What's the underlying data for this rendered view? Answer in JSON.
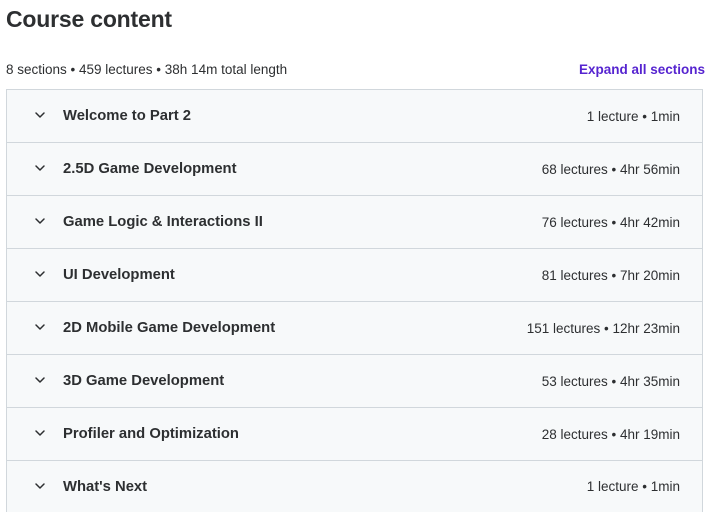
{
  "header": {
    "title": "Course content",
    "summary": "8 sections • 459 lectures • 38h 14m total length",
    "expand_all_label": "Expand all sections"
  },
  "sections": [
    {
      "title": "Welcome to Part 2",
      "meta": "1 lecture • 1min"
    },
    {
      "title": "2.5D Game Development",
      "meta": "68 lectures • 4hr 56min"
    },
    {
      "title": "Game Logic & Interactions II",
      "meta": "76 lectures • 4hr 42min"
    },
    {
      "title": "UI Development",
      "meta": "81 lectures • 7hr 20min"
    },
    {
      "title": "2D Mobile Game Development",
      "meta": "151 lectures • 12hr 23min"
    },
    {
      "title": "3D Game Development",
      "meta": "53 lectures • 4hr 35min"
    },
    {
      "title": "Profiler and Optimization",
      "meta": "28 lectures • 4hr 19min"
    },
    {
      "title": "What's Next",
      "meta": "1 lecture • 1min"
    }
  ],
  "icons": {
    "section_toggle": "chevron-down-icon"
  },
  "colors": {
    "text": "#2d2f31",
    "link": "#5624d0",
    "section_bg": "#f7f9fa",
    "border": "#d1d7dc"
  }
}
